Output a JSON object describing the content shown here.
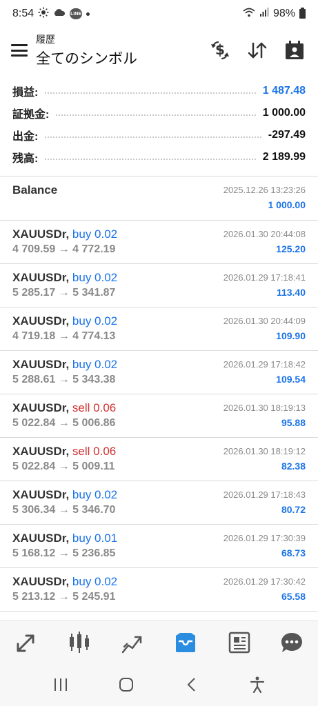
{
  "status_bar": {
    "time": "8:54",
    "line_badge": "LINE",
    "battery": "98%"
  },
  "header": {
    "subtitle": "履歴",
    "title": "全てのシンボル"
  },
  "summary": [
    {
      "label": "損益:",
      "value": "1 487.48",
      "accent": true
    },
    {
      "label": "証拠金:",
      "value": "1 000.00",
      "accent": false
    },
    {
      "label": "出金:",
      "value": "-297.49",
      "accent": false
    },
    {
      "label": "残高:",
      "value": "2 189.99",
      "accent": false
    }
  ],
  "balance_entry": {
    "label": "Balance",
    "time": "2025.12.26 13:23:26",
    "amount": "1 000.00"
  },
  "deals": [
    {
      "symbol": "XAUUSDr,",
      "side": "buy",
      "side_text": "buy 0.02",
      "prices": "4 709.59 → 4 772.19",
      "time": "2026.01.30 20:44:08",
      "profit": "125.20"
    },
    {
      "symbol": "XAUUSDr,",
      "side": "buy",
      "side_text": "buy 0.02",
      "prices": "5 285.17 → 5 341.87",
      "time": "2026.01.29 17:18:41",
      "profit": "113.40"
    },
    {
      "symbol": "XAUUSDr,",
      "side": "buy",
      "side_text": "buy 0.02",
      "prices": "4 719.18 → 4 774.13",
      "time": "2026.01.30 20:44:09",
      "profit": "109.90"
    },
    {
      "symbol": "XAUUSDr,",
      "side": "buy",
      "side_text": "buy 0.02",
      "prices": "5 288.61 → 5 343.38",
      "time": "2026.01.29 17:18:42",
      "profit": "109.54"
    },
    {
      "symbol": "XAUUSDr,",
      "side": "sell",
      "side_text": "sell 0.06",
      "prices": "5 022.84 → 5 006.86",
      "time": "2026.01.30 18:19:13",
      "profit": "95.88"
    },
    {
      "symbol": "XAUUSDr,",
      "side": "sell",
      "side_text": "sell 0.06",
      "prices": "5 022.84 → 5 009.11",
      "time": "2026.01.30 18:19:12",
      "profit": "82.38"
    },
    {
      "symbol": "XAUUSDr,",
      "side": "buy",
      "side_text": "buy 0.02",
      "prices": "5 306.34 → 5 346.70",
      "time": "2026.01.29 17:18:43",
      "profit": "80.72"
    },
    {
      "symbol": "XAUUSDr,",
      "side": "buy",
      "side_text": "buy 0.01",
      "prices": "5 168.12 → 5 236.85",
      "time": "2026.01.29 17:30:39",
      "profit": "68.73"
    },
    {
      "symbol": "XAUUSDr,",
      "side": "buy",
      "side_text": "buy 0.02",
      "prices": "5 213.12 → 5 245.91",
      "time": "2026.01.29 17:30:42",
      "profit": "65.58"
    }
  ],
  "bottom_nav": [
    {
      "name": "quotes-icon",
      "active": false
    },
    {
      "name": "chart-icon",
      "active": false
    },
    {
      "name": "trade-icon",
      "active": false
    },
    {
      "name": "history-icon",
      "active": true
    },
    {
      "name": "news-icon",
      "active": false
    },
    {
      "name": "chat-icon",
      "active": false
    }
  ],
  "colors": {
    "accent": "#1a73e8",
    "sell": "#d32f2f",
    "muted": "#8a8a8a",
    "nav_active": "#2a8de0",
    "nav_inactive": "#555555"
  }
}
